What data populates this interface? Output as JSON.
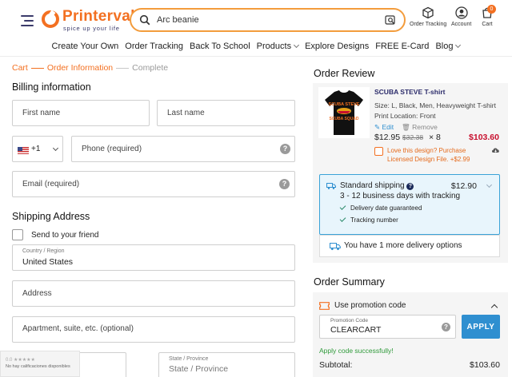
{
  "header": {
    "logo_name": "Printerval",
    "logo_tagline": "spice up your life",
    "search_value": "Arc beanie",
    "actions": {
      "order_tracking": "Order Tracking",
      "account": "Account",
      "cart": "Cart",
      "cart_count": "0"
    }
  },
  "nav": {
    "items": [
      "Create Your Own",
      "Order Tracking",
      "Back To School",
      "Products",
      "Explore Designs",
      "FREE E-Card",
      "Blog"
    ]
  },
  "steps": [
    "Cart",
    "Order Information",
    "Complete"
  ],
  "billing": {
    "title": "Billing information",
    "first_name_ph": "First name",
    "last_name_ph": "Last name",
    "phone_code": "+1",
    "phone_ph": "Phone (required)",
    "email_ph": "Email (required)"
  },
  "shipping": {
    "title": "Shipping Address",
    "send_friend": "Send to your friend",
    "country_label": "Country / Region",
    "country_value": "United States",
    "address_ph": "Address",
    "apt_ph": "Apartment, suite, etc. (optional)",
    "state_label": "State / Province",
    "state_ph": "State / Province"
  },
  "review_widget": {
    "stars": "0.0 ★★★★★",
    "text": "No hay calificaciones disponibles"
  },
  "order_review": {
    "title": "Order Review",
    "product_name": "SCUBA STEVE T-shirt",
    "size_line": "Size: L, Black, Men, Heavyweight T-shirt",
    "print_location": "Print Location: Front",
    "edit": "Edit",
    "remove": "Remove",
    "price": "$12.95",
    "old_price": "$32.38",
    "qty": "× 8",
    "line_total": "$103.60",
    "love_design": "Love this design? Purchase Licensed Design File. +$2.99",
    "shirt_text_1": "SCUBA STEVE",
    "shirt_text_2": "SCUBA SQUAD"
  },
  "shipping_option": {
    "name": "Standard shipping",
    "price": "$12.90",
    "days": "3 - 12 business days with tracking",
    "features": [
      "Delivery date guaranteed",
      "Tracking number"
    ],
    "more": "You have 1 more delivery options"
  },
  "order_summary": {
    "title": "Order Summary",
    "promo_title": "Use promotion code",
    "promo_label": "Promotion Code",
    "promo_value": "CLEARCART",
    "apply": "APPLY",
    "promo_success": "Apply code successfully!",
    "subtotal_label": "Subtotal:",
    "subtotal_value": "$103.60"
  },
  "colors": {
    "brand": "#f37021",
    "link_blue": "#2f8fd0",
    "price_red": "#c8102e",
    "success_green": "#2f9a3a"
  }
}
